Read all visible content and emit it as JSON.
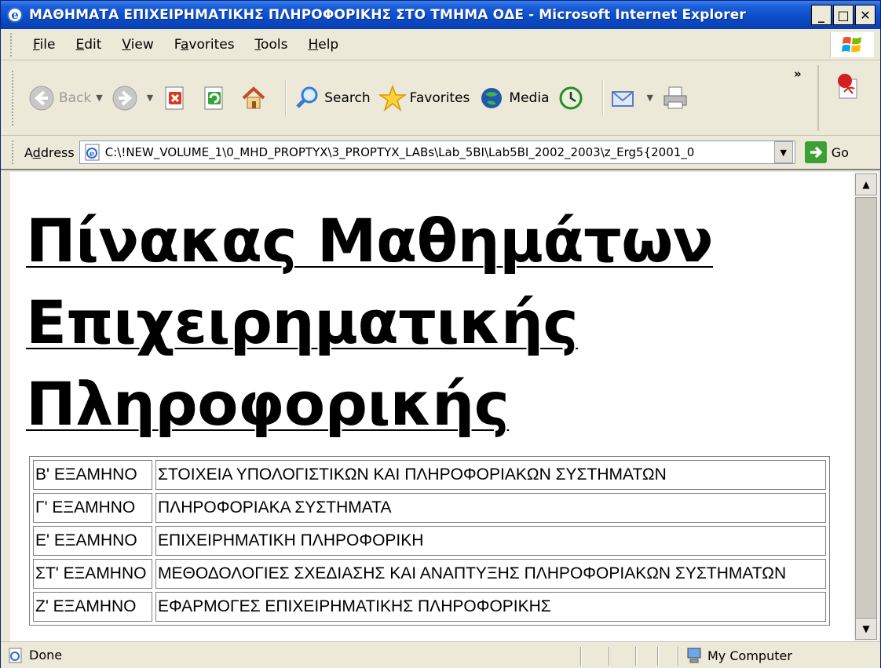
{
  "window": {
    "title": "ΜΑΘΗΜΑΤΑ ΕΠΙΧΕΙΡΗΜΑΤΙΚΗΣ ΠΛΗΡΟΦΟΡΙΚΗΣ ΣΤΟ ΤΜΗΜΑ ΟΔΕ - Microsoft Internet Explorer",
    "minimize": "_",
    "maximize": "□",
    "close": "✕"
  },
  "menu": {
    "items": [
      {
        "key": "F",
        "rest": "ile"
      },
      {
        "key": "E",
        "rest": "dit"
      },
      {
        "key": "V",
        "rest": "iew"
      },
      {
        "pre": "F",
        "key": "a",
        "rest": "vorites"
      },
      {
        "key": "T",
        "rest": "ools"
      },
      {
        "key": "H",
        "rest": "elp"
      }
    ]
  },
  "toolbar": {
    "back": "Back",
    "search": "Search",
    "favorites": "Favorites",
    "media": "Media",
    "chevron": "»"
  },
  "address": {
    "label_pre": "A",
    "label_key": "d",
    "label_post": "dress",
    "value": "C:\\!NEW_VOLUME_1\\0_MHD_PROPTYX\\3_PROPTYX_LABs\\Lab_5BI\\Lab5BI_2002_2003\\z_Erg5{2001_0",
    "go": "Go"
  },
  "page": {
    "heading": "Πίνακας Μαθημάτων Επιχειρηματικής Πληροφορικής",
    "rows": [
      {
        "semester": "Β' ΕΞΑΜΗΝΟ",
        "course": "ΣΤΟΙΧΕΙΑ ΥΠΟΛΟΓΙΣΤΙΚΩΝ ΚΑΙ ΠΛΗΡΟΦΟΡΙΑΚΩΝ ΣΥΣΤΗΜΑΤΩΝ"
      },
      {
        "semester": "Γ' ΕΞΑΜΗΝΟ",
        "course": "ΠΛΗΡΟΦΟΡΙΑΚΑ ΣΥΣΤΗΜΑΤΑ"
      },
      {
        "semester": "Ε' ΕΞΑΜΗΝΟ",
        "course": "ΕΠΙΧΕΙΡΗΜΑΤΙΚΗ ΠΛΗΡΟΦΟΡΙΚΗ"
      },
      {
        "semester": "ΣΤ' ΕΞΑΜΗΝΟ",
        "course": "ΜΕΘΟΔΟΛΟΓΙΕΣ ΣΧΕΔΙΑΣΗΣ ΚΑΙ ΑΝΑΠΤΥΞΗΣ ΠΛΗΡΟΦΟΡΙΑΚΩΝ ΣΥΣΤΗΜΑΤΩΝ"
      },
      {
        "semester": "Ζ' ΕΞΑΜΗΝΟ",
        "course": "ΕΦΑΡΜΟΓΕΣ ΕΠΙΧΕΙΡΗΜΑΤΙΚΗΣ ΠΛΗΡΟΦΟΡΙΚΗΣ"
      }
    ]
  },
  "status": {
    "text": "Done",
    "zone": "My Computer"
  },
  "colors": {
    "titlebar": "#0b4cc8",
    "chrome": "#ece9d8",
    "go_green": "#3ca035"
  },
  "icons": [
    "ie-icon",
    "windows-logo-icon",
    "back-arrow-icon",
    "forward-arrow-icon",
    "stop-icon",
    "refresh-icon",
    "home-icon",
    "search-icon",
    "favorites-star-icon",
    "media-icon",
    "history-icon",
    "mail-icon",
    "print-icon",
    "pdf-icon",
    "go-arrow-icon",
    "computer-icon"
  ]
}
